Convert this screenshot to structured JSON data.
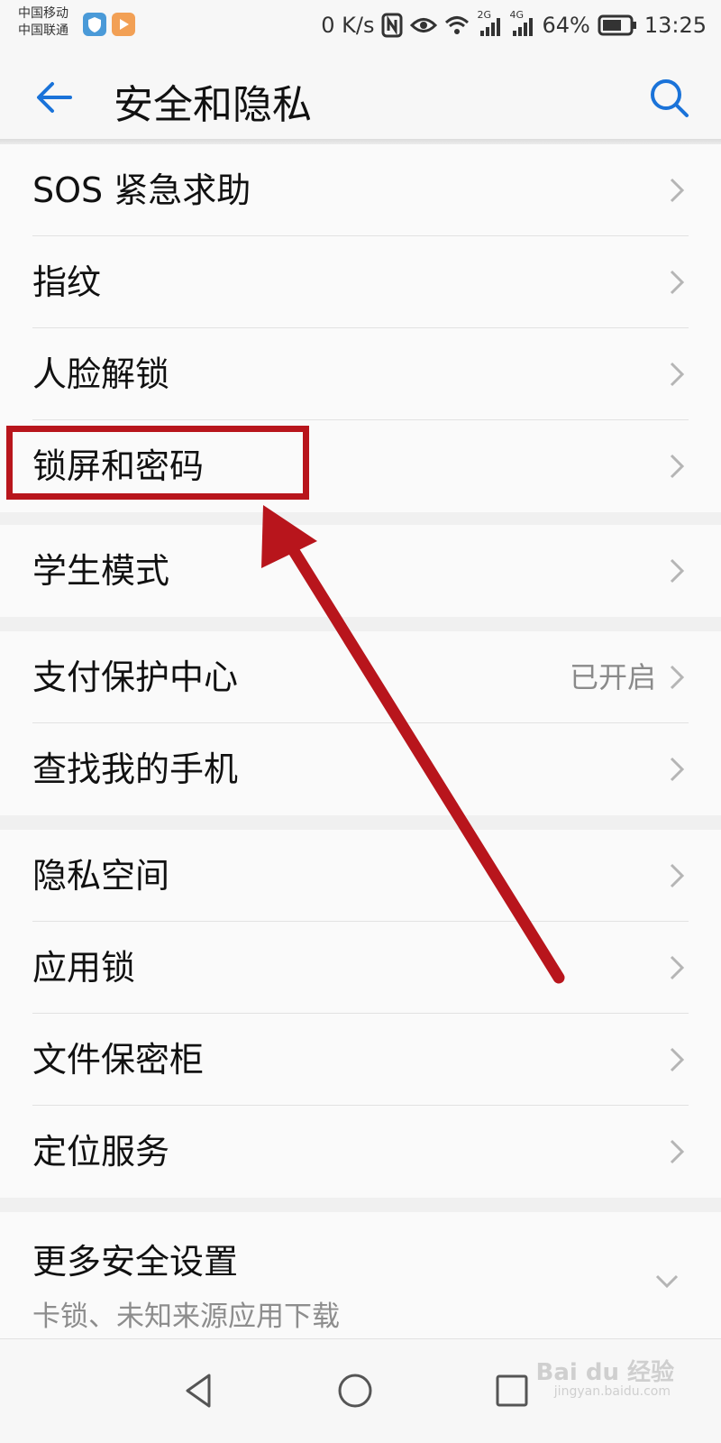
{
  "status_bar": {
    "carrier_1": "中国移动",
    "carrier_2": "中国联通",
    "speed": "0 K/s",
    "net_2g": "2G",
    "net_4g": "4G",
    "battery": "64%",
    "time": "13:25"
  },
  "header": {
    "title": "安全和隐私",
    "back_icon": "back-arrow-icon",
    "search_icon": "search-icon"
  },
  "groups": [
    {
      "items": [
        {
          "label": "SOS 紧急求助"
        },
        {
          "label": "指纹"
        },
        {
          "label": "人脸解锁"
        },
        {
          "label": "锁屏和密码"
        }
      ]
    },
    {
      "items": [
        {
          "label": "学生模式"
        }
      ]
    },
    {
      "items": [
        {
          "label": "支付保护中心",
          "value": "已开启"
        },
        {
          "label": "查找我的手机"
        }
      ]
    },
    {
      "items": [
        {
          "label": "隐私空间"
        },
        {
          "label": "应用锁"
        },
        {
          "label": "文件保密柜"
        },
        {
          "label": "定位服务"
        }
      ]
    },
    {
      "items": [
        {
          "label": "更多安全设置",
          "sublabel": "卡锁、未知来源应用下载"
        }
      ]
    }
  ],
  "watermark": {
    "text": "Bai du 经验",
    "sub": "jingyan.baidu.com"
  },
  "colors": {
    "accent": "#1a73d9",
    "annotation": "#b8151c"
  }
}
